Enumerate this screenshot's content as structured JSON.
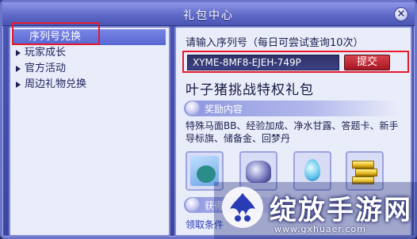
{
  "window": {
    "title": "礼包中心",
    "close_symbol": "×"
  },
  "sidebar": {
    "items": [
      {
        "label": "序列号兑换",
        "selected": true
      },
      {
        "label": "玩家成长",
        "selected": false
      },
      {
        "label": "官方活动",
        "selected": false
      },
      {
        "label": "周边礼物兑换",
        "selected": false
      }
    ]
  },
  "redeem": {
    "prompt": "请输入序列号（每日可尝试查询10次）",
    "code_value": "XYME-8MF8-EJEH-749P",
    "submit_label": "提交"
  },
  "pack": {
    "title": "叶子猪挑战特权礼包",
    "rewards_heading": "奖励内容",
    "rewards_text": "特殊马面BB、经验加成、净水甘露、答题卡、新手导标旗、储备金、回梦丹",
    "items": [
      {
        "icon": "pet-card-icon"
      },
      {
        "icon": "mount-icon"
      },
      {
        "icon": "water-drop-icon"
      },
      {
        "icon": "gold-bars-icon"
      }
    ],
    "obtain_heading": "获得",
    "claim_text": "领取条件"
  },
  "watermark": {
    "text": "绽放手游网",
    "url": "www.gxhuaer.com"
  },
  "colors": {
    "highlight": "#e8192c",
    "panel": "#e9ecf9",
    "frame": "#4a55b4",
    "submit": "#c12631"
  }
}
